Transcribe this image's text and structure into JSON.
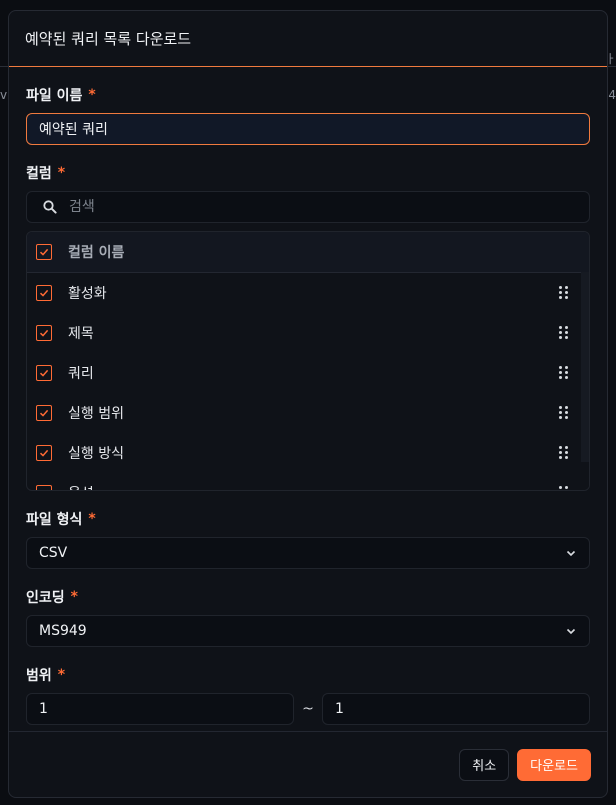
{
  "background": {
    "edge_glyph_top": "ㅏ",
    "edge_glyph_mid": "4",
    "edge_glyph_left": "v"
  },
  "dialog": {
    "title": "예약된 쿼리 목록 다운로드",
    "accent_color": "#ff6b35"
  },
  "file_name": {
    "label": "파일 이름",
    "required_mark": "*",
    "value": "예약된 쿼리"
  },
  "columns": {
    "label": "컬럼",
    "required_mark": "*",
    "search_placeholder": "검색",
    "header_label": "컬럼 이름",
    "items": [
      {
        "label": "활성화",
        "checked": true
      },
      {
        "label": "제목",
        "checked": true
      },
      {
        "label": "쿼리",
        "checked": true
      },
      {
        "label": "실행 범위",
        "checked": true
      },
      {
        "label": "실행 방식",
        "checked": true
      },
      {
        "label": "옵션",
        "checked": true
      }
    ]
  },
  "file_format": {
    "label": "파일 형식",
    "required_mark": "*",
    "selected": "CSV"
  },
  "encoding": {
    "label": "인코딩",
    "required_mark": "*",
    "selected": "MS949"
  },
  "range": {
    "label": "범위",
    "required_mark": "*",
    "from": "1",
    "separator": "~",
    "to": "1"
  },
  "footer": {
    "cancel_label": "취소",
    "download_label": "다운로드"
  }
}
